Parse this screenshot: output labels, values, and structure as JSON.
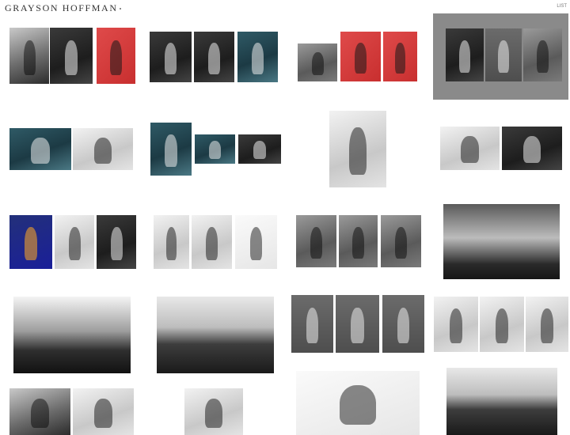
{
  "header": {
    "site_title": "GRAYSON HOFFMAN",
    "title_mark": "•",
    "nav_link": "LIST"
  },
  "gallery": {
    "tiles": [
      {
        "name": "series-tile-1",
        "photos": [
          "mixed",
          "dark",
          "red"
        ]
      },
      {
        "name": "series-tile-2",
        "photos": [
          "dark",
          "dark",
          "teal"
        ]
      },
      {
        "name": "series-tile-3",
        "photos": [
          "mid",
          "red",
          "red"
        ]
      },
      {
        "name": "series-tile-4",
        "photos": [
          "dark",
          "grey",
          "mid"
        ],
        "selected": true
      },
      {
        "name": "series-tile-5",
        "photos": [
          "teal",
          "light"
        ]
      },
      {
        "name": "series-tile-6",
        "photos": [
          "teal",
          "teal",
          "dark"
        ]
      },
      {
        "name": "series-tile-7",
        "photos": [
          "light"
        ]
      },
      {
        "name": "series-tile-8",
        "photos": [
          "light",
          "dark"
        ]
      },
      {
        "name": "series-tile-9",
        "photos": [
          "blue",
          "light",
          "dark"
        ]
      },
      {
        "name": "series-tile-10",
        "photos": [
          "light",
          "light",
          "white"
        ]
      },
      {
        "name": "series-tile-11",
        "photos": [
          "mid",
          "mid",
          "mid"
        ]
      },
      {
        "name": "series-tile-12",
        "photos": [
          "sky"
        ]
      },
      {
        "name": "series-tile-13",
        "photos": [
          "mountain"
        ]
      },
      {
        "name": "series-tile-14",
        "photos": [
          "landscape"
        ]
      },
      {
        "name": "series-tile-15",
        "photos": [
          "grey",
          "grey",
          "grey"
        ]
      },
      {
        "name": "series-tile-16",
        "photos": [
          "light",
          "light",
          "light"
        ]
      },
      {
        "name": "series-tile-17",
        "photos": [
          "mixed",
          "light"
        ]
      },
      {
        "name": "series-tile-18",
        "photos": [
          "light"
        ]
      },
      {
        "name": "series-tile-19",
        "photos": [
          "white"
        ]
      },
      {
        "name": "series-tile-20",
        "photos": [
          "landscape"
        ]
      }
    ]
  }
}
